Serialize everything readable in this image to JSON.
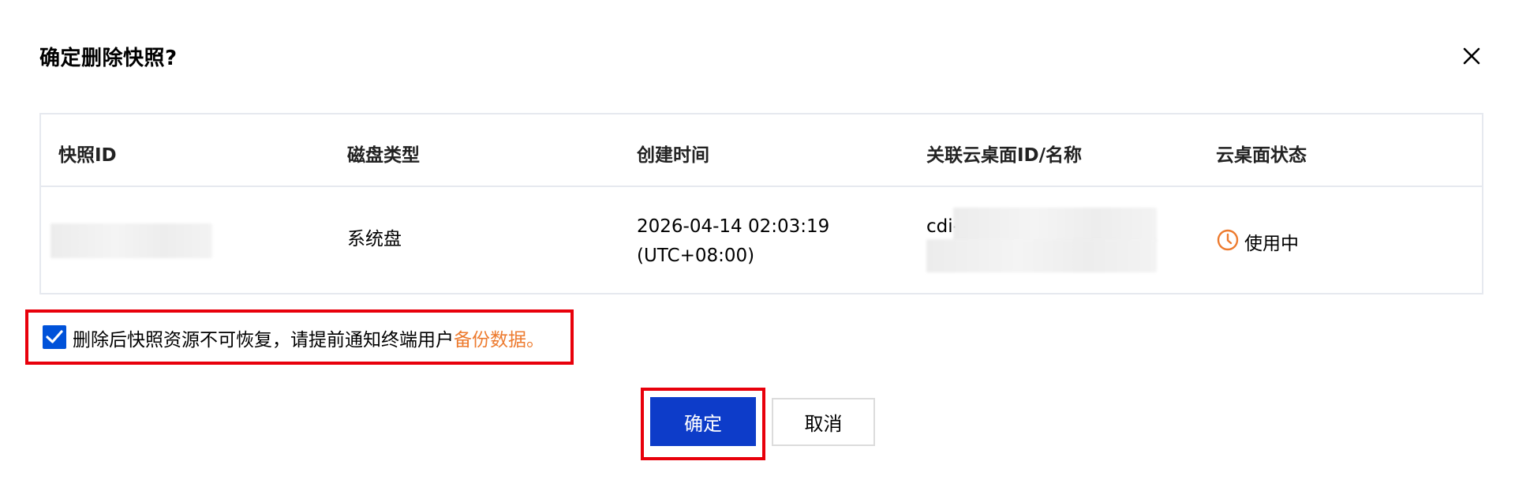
{
  "dialog": {
    "title": "确定删除快照?",
    "close_icon": "close-icon"
  },
  "table": {
    "headers": [
      "快照ID",
      "磁盘类型",
      "创建时间",
      "关联云桌面ID/名称",
      "云桌面状态"
    ],
    "row": {
      "snapshot_id": "",
      "disk_type": "系统盘",
      "created_date": "2026-04-14 02:03:19",
      "created_tz": "(UTC+08:00)",
      "desktop_id_prefix": "cdi-",
      "status_icon": "clock-icon",
      "status": "使用中"
    }
  },
  "confirm": {
    "checked": true,
    "text": "删除后快照资源不可恢复，请提前通知终端用户",
    "link": "备份数据。"
  },
  "buttons": {
    "ok": "确定",
    "cancel": "取消"
  },
  "colors": {
    "primary": "#0d3cc9",
    "checkbox": "#0052d9",
    "warning": "#ed7b2f",
    "highlight": "#e8000b"
  }
}
